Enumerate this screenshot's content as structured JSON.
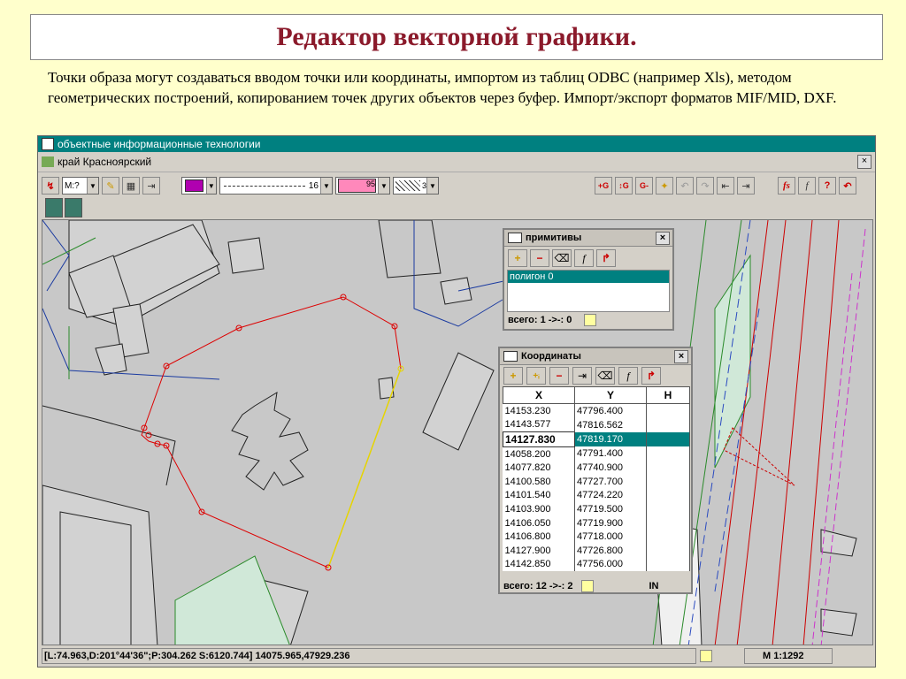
{
  "slide": {
    "title": "Редактор векторной графики.",
    "description": "Точки образа могут создаваться вводом точки или координаты, импортом из таблиц ODBC (например Xls), методом геометрических построений, копированием  точек других объектов через буфер. Импорт/экспорт форматов MIF/MID, DXF."
  },
  "app": {
    "title": "объектные информационные технологии",
    "document_title": "край Красноярский",
    "close_glyph": "×"
  },
  "toolbar": {
    "style_combo_value": "M:?",
    "line_combo_value": "16",
    "fill_combo_value": "95",
    "hatch_combo_value": "3",
    "fill_color": "#b000b0",
    "pink_color": "#ff88bb",
    "btn_add_point": "+G",
    "btn_edit_point": "↕G",
    "btn_del_point": "G-",
    "btn_fs": "fs",
    "btn_f": "f",
    "btn_help": "?",
    "btn_undo": "↶"
  },
  "primitives_panel": {
    "title": "примитивы",
    "items": [
      "полигон 0"
    ],
    "footer_text": "всего: 1 ->-: 0"
  },
  "coords_panel": {
    "title": "Координаты",
    "headers": [
      "X",
      "Y",
      "H"
    ],
    "rows": [
      [
        "14153.230",
        "47796.400"
      ],
      [
        "14143.577",
        "47816.562"
      ],
      [
        "14127.830",
        "47819.170"
      ],
      [
        "14058.200",
        "47791.400"
      ],
      [
        "14077.820",
        "47740.900"
      ],
      [
        "14100.580",
        "47727.700"
      ],
      [
        "14101.540",
        "47724.220"
      ],
      [
        "14103.900",
        "47719.500"
      ],
      [
        "14106.050",
        "47719.900"
      ],
      [
        "14106.800",
        "47718.000"
      ],
      [
        "14127.900",
        "47726.800"
      ],
      [
        "14142.850",
        "47756.000"
      ]
    ],
    "selected_row": 2,
    "footer_text": "всего: 12 ->-: 2",
    "footer_extra": "IN"
  },
  "statusbar": {
    "coords_text": "[L:74.963,D:201°44'36\";P:304.262 S:6120.744] 14075.965,47929.236",
    "scale_text": "M 1:1292"
  },
  "icons": {
    "toolbar_icons": [
      "pointer-icon",
      "style-icon",
      "pencil-icon",
      "grid-icon",
      "import-icon"
    ],
    "panel_icons": [
      "add-icon",
      "delete-icon",
      "eraser-icon",
      "function-icon",
      "return-icon"
    ]
  }
}
